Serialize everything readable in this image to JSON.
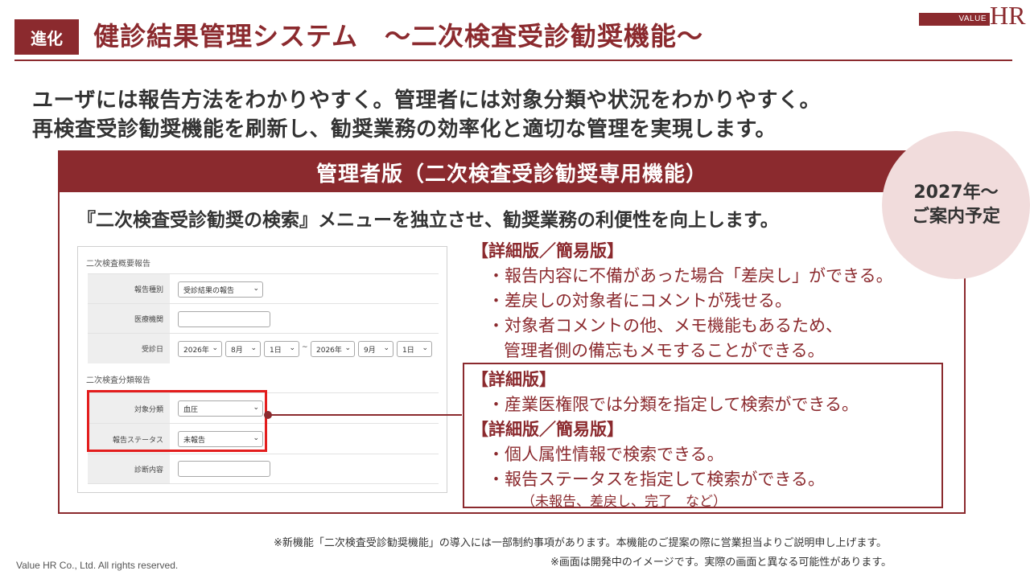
{
  "header": {
    "tag": "進化",
    "title": "健診結果管理システム　～二次検査受診勧奨機能～",
    "logo": {
      "bar_text": "VALUE",
      "mark": "HR"
    }
  },
  "lead": {
    "line1": "ユーザには報告方法をわかりやすく。管理者には対象分類や状況をわかりやすく。",
    "line2": "再検査受診勧奨機能を刷新し、勧奨業務の効率化と適切な管理を実現します。"
  },
  "badge": {
    "line1": "2027年～",
    "line2": "ご案内予定"
  },
  "panel": {
    "title": "管理者版（二次検査受診勧奨専用機能）",
    "description": "『二次検査受診勧奨の検索』メニューを独立させ、勧奨業務の利便性を向上します。"
  },
  "form": {
    "section1": "二次検査概要報告",
    "report_type": {
      "label": "報告種別",
      "value": "受診結果の報告"
    },
    "institution": {
      "label": "医療機関",
      "value": ""
    },
    "exam_date": {
      "label": "受診日",
      "from_year": "2026年",
      "from_month": "8月",
      "from_day": "1日",
      "separator": "~",
      "to_year": "2026年",
      "to_month": "9月",
      "to_day": "1日"
    },
    "section2": "二次検査分類報告",
    "category": {
      "label": "対象分類",
      "value": "血圧"
    },
    "status": {
      "label": "報告ステータス",
      "value": "未報告"
    },
    "diagnosis": {
      "label": "診断内容",
      "value": ""
    }
  },
  "features_top": {
    "title": "【詳細版／簡易版】",
    "items": [
      "・報告内容に不備があった場合「差戻し」ができる。",
      "・差戻しの対象者にコメントが残せる。",
      "・対象者コメントの他、メモ機能もあるため、",
      "管理者側の備忘もメモすることができる。"
    ]
  },
  "features_box": {
    "title1": "【詳細版】",
    "item1": "・産業医権限では分類を指定して検索ができる。",
    "title2": "【詳細版／簡易版】",
    "item2": "・個人属性情報で検索できる。",
    "item3": "・報告ステータスを指定して検索ができる。",
    "item3_note": "（未報告、差戻し、完了　など）"
  },
  "footer": {
    "note1": "※新機能「二次検査受診勧奨機能」の導入には一部制約事項があります。本機能のご提案の際に営業担当よりご説明申し上げます。",
    "note2": "※画面は開発中のイメージです。実際の画面と異なる可能性があります。",
    "copyright": "Value HR Co., Ltd. All rights reserved."
  },
  "colors": {
    "brand": "#8b2a2e",
    "highlight": "#e31d1d",
    "badge_bg": "#f1dcdc"
  }
}
